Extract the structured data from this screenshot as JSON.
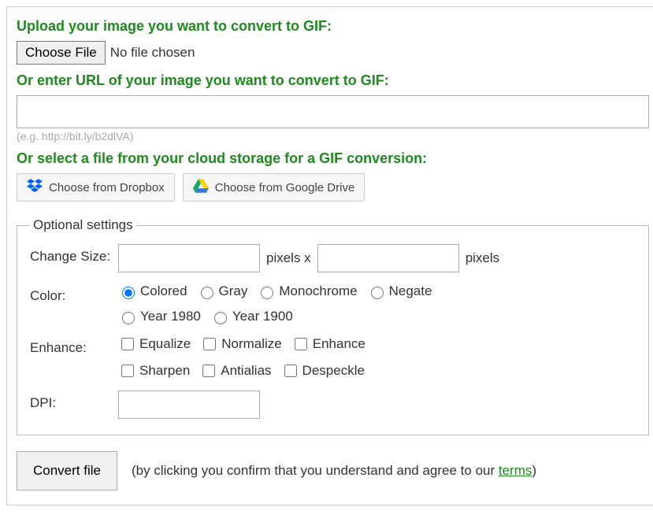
{
  "upload": {
    "heading": "Upload your image you want to convert to GIF:",
    "choose_label": "Choose File",
    "no_file_text": "No file chosen"
  },
  "url": {
    "heading": "Or enter URL of your image you want to convert to GIF:",
    "value": "",
    "hint": "(e.g. http://bit.ly/b2dlVA)"
  },
  "cloud": {
    "heading": "Or select a file from your cloud storage for a GIF conversion:",
    "dropbox_label": "Choose from Dropbox",
    "drive_label": "Choose from Google Drive"
  },
  "optional": {
    "legend": "Optional settings",
    "size": {
      "label": "Change Size:",
      "sep": "pixels x",
      "suffix": "pixels"
    },
    "color": {
      "label": "Color:",
      "options": {
        "colored": "Colored",
        "gray": "Gray",
        "monochrome": "Monochrome",
        "negate": "Negate",
        "year1980": "Year 1980",
        "year1900": "Year 1900"
      }
    },
    "enhance": {
      "label": "Enhance:",
      "options": {
        "equalize": "Equalize",
        "normalize": "Normalize",
        "enhance": "Enhance",
        "sharpen": "Sharpen",
        "antialias": "Antialias",
        "despeckle": "Despeckle"
      }
    },
    "dpi": {
      "label": "DPI:"
    }
  },
  "submit": {
    "button": "Convert file",
    "disclaimer_prefix": "(by clicking you confirm that you understand and agree to our ",
    "terms": "terms",
    "disclaimer_suffix": ")"
  }
}
